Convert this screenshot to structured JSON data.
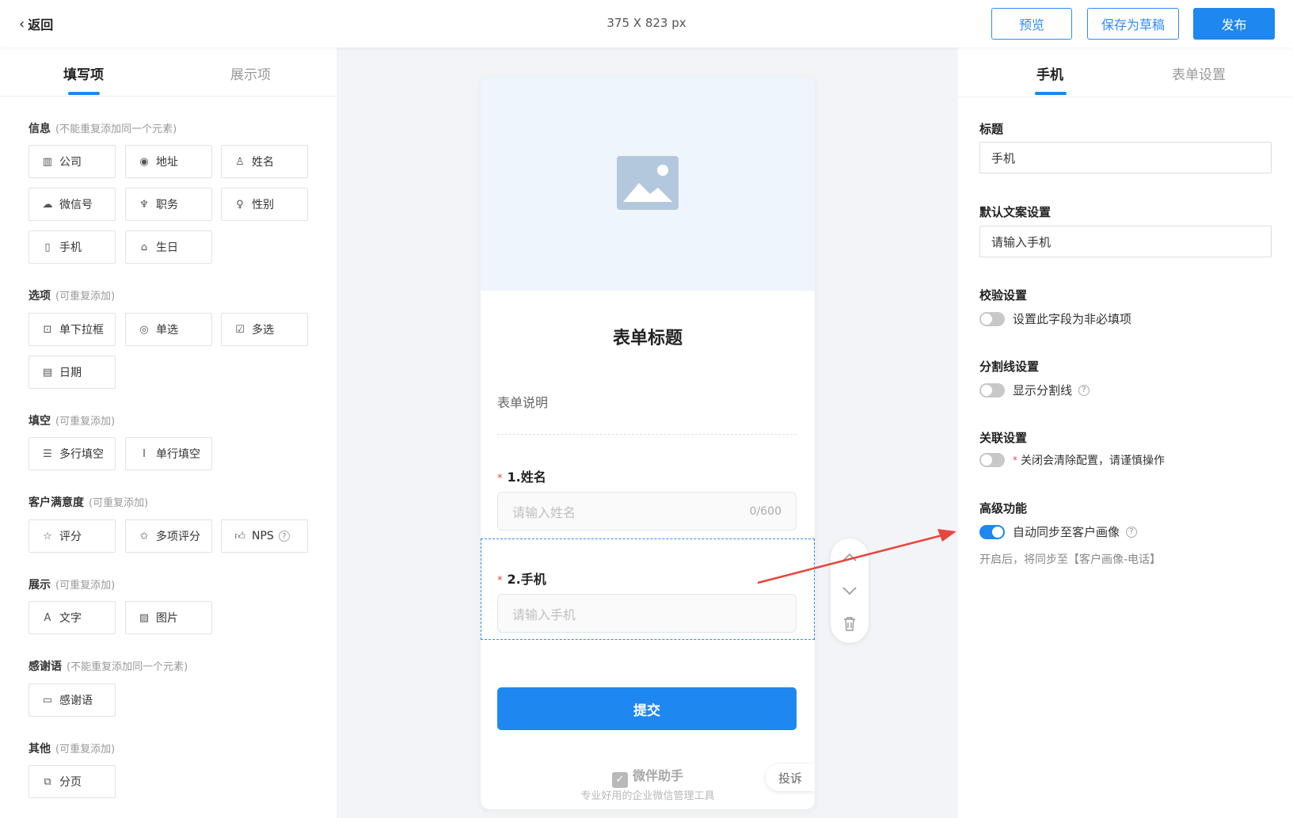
{
  "topbar": {
    "back_label": "返回",
    "dimensions": "375 X 823 px",
    "preview_label": "预览",
    "save_draft_label": "保存为草稿",
    "publish_label": "发布"
  },
  "left_panel": {
    "tabs": [
      "填写项",
      "展示项"
    ],
    "sections": [
      {
        "title": "信息",
        "note": "(不能重复添加同一个元素)",
        "items": [
          {
            "label": "公司",
            "icon": "building-icon"
          },
          {
            "label": "地址",
            "icon": "location-icon"
          },
          {
            "label": "姓名",
            "icon": "user-icon"
          },
          {
            "label": "微信号",
            "icon": "wechat-icon"
          },
          {
            "label": "职务",
            "icon": "tie-icon"
          },
          {
            "label": "性别",
            "icon": "gender-icon"
          },
          {
            "label": "手机",
            "icon": "phone-icon"
          },
          {
            "label": "生日",
            "icon": "cake-icon"
          }
        ]
      },
      {
        "title": "选项",
        "note": "(可重复添加)",
        "items": [
          {
            "label": "单下拉框",
            "icon": "dropdown-icon"
          },
          {
            "label": "单选",
            "icon": "radio-icon"
          },
          {
            "label": "多选",
            "icon": "checkbox-icon"
          },
          {
            "label": "日期",
            "icon": "calendar-icon"
          }
        ]
      },
      {
        "title": "填空",
        "note": "(可重复添加)",
        "items": [
          {
            "label": "多行填空",
            "icon": "multiline-icon"
          },
          {
            "label": "单行填空",
            "icon": "singleline-icon"
          }
        ]
      },
      {
        "title": "客户满意度",
        "note": "(可重复添加)",
        "items": [
          {
            "label": "评分",
            "icon": "star-icon"
          },
          {
            "label": "多项评分",
            "icon": "multi-star-icon"
          },
          {
            "label": "NPS",
            "icon": "thumb-up-icon"
          }
        ]
      },
      {
        "title": "展示",
        "note": "(可重复添加)",
        "items": [
          {
            "label": "文字",
            "icon": "text-icon"
          },
          {
            "label": "图片",
            "icon": "image-icon"
          }
        ]
      },
      {
        "title": "感谢语",
        "note": "(不能重复添加同一个元素)",
        "items": [
          {
            "label": "感谢语",
            "icon": "message-icon"
          }
        ]
      },
      {
        "title": "其他",
        "note": "(可重复添加)",
        "items": [
          {
            "label": "分页",
            "icon": "page-break-icon"
          }
        ]
      }
    ]
  },
  "preview": {
    "form_title": "表单标题",
    "form_description": "表单说明",
    "questions": [
      {
        "number_label": "1.姓名",
        "placeholder": "请输入姓名",
        "counter": "0/600"
      },
      {
        "number_label": "2.手机",
        "placeholder": "请输入手机"
      }
    ],
    "submit_label": "提交",
    "brand_name": "微伴助手",
    "brand_tagline": "专业好用的企业微信管理工具",
    "complain_label": "投诉"
  },
  "right_panel": {
    "tabs": [
      "手机",
      "表单设置"
    ],
    "title_label": "标题",
    "title_value": "手机",
    "default_text_label": "默认文案设置",
    "default_text_value": "请输入手机",
    "validation_label": "校验设置",
    "validation_toggle_text": "设置此字段为非必填项",
    "divider_label": "分割线设置",
    "divider_toggle_text": "显示分割线",
    "association_label": "关联设置",
    "association_warning": "关闭会清除配置，请谨慎操作",
    "advanced_label": "高级功能",
    "advanced_toggle_text": "自动同步至客户画像",
    "advanced_hint": "开启后，将同步至【客户画像-电话】"
  },
  "colors": {
    "primary": "#1e87f0",
    "required": "#e5483b",
    "annotation_arrow": "#e8453c"
  }
}
